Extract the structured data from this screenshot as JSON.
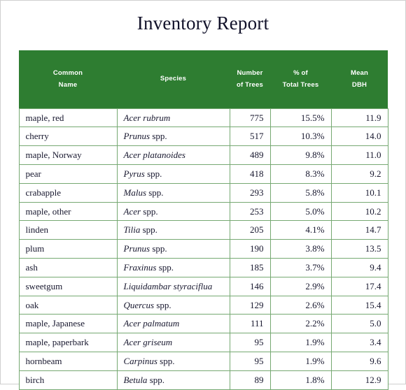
{
  "page": {
    "title": "Inventory Report",
    "accent_color": "#2E7D31",
    "border_color": "#76A972",
    "header_text_color": "#FFFFFF",
    "body_text_color": "#17172E",
    "page_border_color": "#CFCFCF"
  },
  "table": {
    "columns": [
      {
        "key": "common_name",
        "label": "Common Name",
        "label_lines": [
          "Common",
          "Name"
        ],
        "align": "left"
      },
      {
        "key": "species",
        "label": "Species",
        "label_lines": [
          "Species"
        ],
        "align": "left"
      },
      {
        "key": "number_of_trees",
        "label": "Number of Trees",
        "label_lines": [
          "Number",
          "of Trees"
        ],
        "align": "right"
      },
      {
        "key": "pct_total_trees",
        "label": "% of Total Trees",
        "label_lines": [
          "% of",
          "Total Trees"
        ],
        "align": "right"
      },
      {
        "key": "mean_dbh",
        "label": "Mean DBH",
        "label_lines": [
          "Mean",
          "DBH"
        ],
        "align": "right"
      }
    ],
    "rows": [
      {
        "common_name": "maple, red",
        "genus": "Acer",
        "qualifier": " rubrum",
        "species_italic_all": true,
        "species": "Acer rubrum",
        "number_of_trees": "775",
        "pct_total_trees": "15.5%",
        "mean_dbh": "11.9"
      },
      {
        "common_name": "cherry",
        "genus": "Prunus",
        "qualifier": " spp.",
        "species_italic_all": false,
        "species": "Prunus spp.",
        "number_of_trees": "517",
        "pct_total_trees": "10.3%",
        "mean_dbh": "14.0"
      },
      {
        "common_name": "maple, Norway",
        "genus": "Acer",
        "qualifier": " platanoides",
        "species_italic_all": true,
        "species": "Acer platanoides",
        "number_of_trees": "489",
        "pct_total_trees": "9.8%",
        "mean_dbh": "11.0"
      },
      {
        "common_name": "pear",
        "genus": "Pyrus",
        "qualifier": " spp.",
        "species_italic_all": false,
        "species": "Pyrus spp.",
        "number_of_trees": "418",
        "pct_total_trees": "8.3%",
        "mean_dbh": "9.2"
      },
      {
        "common_name": "crabapple",
        "genus": "Malus",
        "qualifier": " spp.",
        "species_italic_all": false,
        "species": "Malus spp.",
        "number_of_trees": "293",
        "pct_total_trees": "5.8%",
        "mean_dbh": "10.1"
      },
      {
        "common_name": "maple, other",
        "genus": "Acer",
        "qualifier": " spp.",
        "species_italic_all": false,
        "species": "Acer spp.",
        "number_of_trees": "253",
        "pct_total_trees": "5.0%",
        "mean_dbh": "10.2"
      },
      {
        "common_name": "linden",
        "genus": "Tilia",
        "qualifier": " spp.",
        "species_italic_all": false,
        "species": "Tilia spp.",
        "number_of_trees": "205",
        "pct_total_trees": "4.1%",
        "mean_dbh": "14.7"
      },
      {
        "common_name": "plum",
        "genus": "Prunus",
        "qualifier": " spp.",
        "species_italic_all": false,
        "species": "Prunus spp.",
        "number_of_trees": "190",
        "pct_total_trees": "3.8%",
        "mean_dbh": "13.5"
      },
      {
        "common_name": "ash",
        "genus": "Fraxinus",
        "qualifier": " spp.",
        "species_italic_all": false,
        "species": "Fraxinus spp.",
        "number_of_trees": "185",
        "pct_total_trees": "3.7%",
        "mean_dbh": "9.4"
      },
      {
        "common_name": "sweetgum",
        "genus": "Liquidambar",
        "qualifier": " styraciflua",
        "species_italic_all": true,
        "species": "Liquidambar styraciflua",
        "number_of_trees": "146",
        "pct_total_trees": "2.9%",
        "mean_dbh": "17.4"
      },
      {
        "common_name": "oak",
        "genus": "Quercus",
        "qualifier": " spp.",
        "species_italic_all": false,
        "species": "Quercus spp.",
        "number_of_trees": "129",
        "pct_total_trees": "2.6%",
        "mean_dbh": "15.4"
      },
      {
        "common_name": "maple, Japanese",
        "genus": "Acer",
        "qualifier": " palmatum",
        "species_italic_all": true,
        "species": "Acer palmatum",
        "number_of_trees": "111",
        "pct_total_trees": "2.2%",
        "mean_dbh": "5.0"
      },
      {
        "common_name": "maple, paperbark",
        "genus": "Acer",
        "qualifier": " griseum",
        "species_italic_all": true,
        "species": "Acer griseum",
        "number_of_trees": "95",
        "pct_total_trees": "1.9%",
        "mean_dbh": "3.4"
      },
      {
        "common_name": "hornbeam",
        "genus": "Carpinus",
        "qualifier": " spp.",
        "species_italic_all": false,
        "species": "Carpinus spp.",
        "number_of_trees": "95",
        "pct_total_trees": "1.9%",
        "mean_dbh": "9.6"
      },
      {
        "common_name": "birch",
        "genus": "Betula",
        "qualifier": " spp.",
        "species_italic_all": false,
        "species": "Betula spp.",
        "number_of_trees": "89",
        "pct_total_trees": "1.8%",
        "mean_dbh": "12.9"
      }
    ]
  },
  "chart_data": {
    "type": "table",
    "title": "Inventory Report",
    "columns": [
      "Common Name",
      "Species",
      "Number of Trees",
      "% of Total Trees",
      "Mean DBH"
    ],
    "categories": [
      "maple, red",
      "cherry",
      "maple, Norway",
      "pear",
      "crabapple",
      "maple, other",
      "linden",
      "plum",
      "ash",
      "sweetgum",
      "oak",
      "maple, Japanese",
      "maple, paperbark",
      "hornbeam",
      "birch"
    ],
    "series": [
      {
        "name": "Number of Trees",
        "values": [
          775,
          517,
          489,
          418,
          293,
          253,
          205,
          190,
          185,
          146,
          129,
          111,
          95,
          95,
          89
        ]
      },
      {
        "name": "% of Total Trees",
        "values": [
          15.5,
          10.3,
          9.8,
          8.3,
          5.8,
          5.0,
          4.1,
          3.8,
          3.7,
          2.9,
          2.6,
          2.2,
          1.9,
          1.9,
          1.8
        ]
      },
      {
        "name": "Mean DBH",
        "values": [
          11.9,
          14.0,
          11.0,
          9.2,
          10.1,
          10.2,
          14.7,
          13.5,
          9.4,
          17.4,
          15.4,
          5.0,
          3.4,
          9.6,
          12.9
        ]
      }
    ],
    "species_values": [
      "Acer rubrum",
      "Prunus spp.",
      "Acer platanoides",
      "Pyrus spp.",
      "Malus spp.",
      "Acer spp.",
      "Tilia spp.",
      "Prunus spp.",
      "Fraxinus spp.",
      "Liquidambar styraciflua",
      "Quercus spp.",
      "Acer palmatum",
      "Acer griseum",
      "Carpinus spp.",
      "Betula spp."
    ],
    "xlabel": "",
    "ylabel": "",
    "grid": true,
    "legend": "none"
  }
}
